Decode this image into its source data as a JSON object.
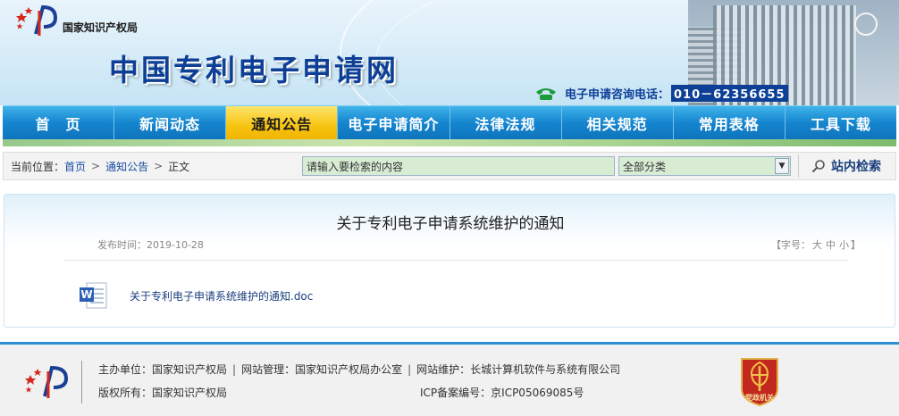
{
  "header": {
    "org_name": "国家知识产权局",
    "site_title": "中国专利电子申请网",
    "hotline_label": "电子申请咨询电话：",
    "hotline_number": "010－62356655"
  },
  "nav": {
    "items": [
      {
        "label": "首　页"
      },
      {
        "label": "新闻动态"
      },
      {
        "label": "通知公告"
      },
      {
        "label": "电子申请简介"
      },
      {
        "label": "法律法规"
      },
      {
        "label": "相关规范"
      },
      {
        "label": "常用表格"
      },
      {
        "label": "工具下载"
      }
    ],
    "active_index": 2
  },
  "breadcrumb": {
    "prefix": "当前位置：",
    "home": "首页",
    "section": "通知公告",
    "current": "正文",
    "separator": ">"
  },
  "search": {
    "placeholder": "请输入要检索的内容",
    "category_selected": "全部分类",
    "button_label": "站内检索"
  },
  "article": {
    "title": "关于专利电子申请系统维护的通知",
    "publish_label": "发布时间：",
    "publish_date": "2019-10-28",
    "font_size_label": "【字号：",
    "font_size_large": "大",
    "font_size_medium": "中",
    "font_size_small": "小",
    "font_size_close": "】",
    "attachment_name": "关于专利电子申请系统维护的通知.doc"
  },
  "footer": {
    "sponsor": "主办单位：国家知识产权局",
    "manager": "网站管理：国家知识产权局办公室",
    "maintainer": "网站维护：长城计算机软件与系统有限公司",
    "copyright": "版权所有：国家知识产权局",
    "icp": "ICP备案编号：京ICP05069085号",
    "badge_text": "党政机关"
  },
  "colors": {
    "nav_blue": "#1585cf",
    "nav_active": "#f7c412",
    "title_blue": "#0d3f96",
    "footer_border": "#2c8fd2"
  }
}
